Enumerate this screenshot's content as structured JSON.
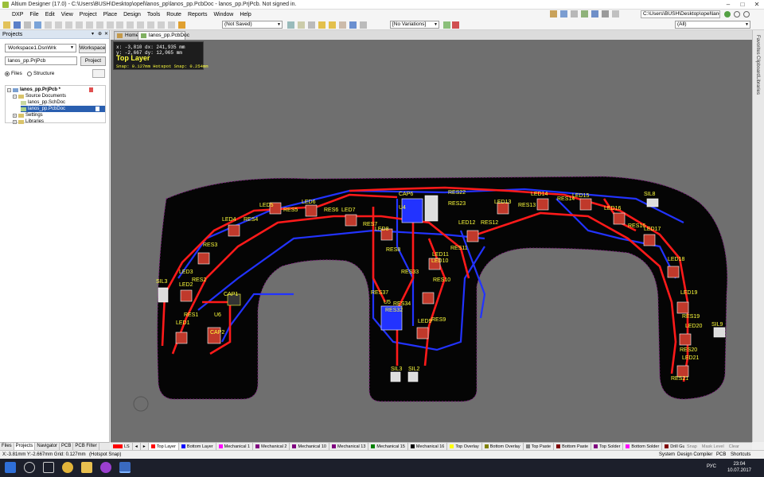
{
  "window": {
    "title": "Altium Designer (17.0) - C:\\Users\\BUSH\\Desktop\\opel\\lanos_pp\\lanos_pp.PcbDoc - lanos_pp.PrjPcb. Not signed in.",
    "path_box": "C:\\Users\\BUSH\\Desktop\\opel\\lano",
    "min": "–",
    "max": "□",
    "close": "✕"
  },
  "menu": [
    "DXP",
    "File",
    "Edit",
    "View",
    "Project",
    "Place",
    "Design",
    "Tools",
    "Route",
    "Reports",
    "Window",
    "Help"
  ],
  "toolbar": {
    "saved_combo": "(Not Saved)",
    "variations_combo": "[No Variations]",
    "filter_combo": "(All)"
  },
  "panel": {
    "title": "Projects",
    "workspace_field": "Workspace1.DsnWrk",
    "workspace_button": "Workspace",
    "project_field": "lanos_pp.PrjPcb",
    "project_button": "Project",
    "radio_files": "Files",
    "radio_structure": "Structure",
    "tree": [
      {
        "label": "lanos_pp.PrjPcb *",
        "level": 0
      },
      {
        "label": "Source Documents",
        "level": 1
      },
      {
        "label": "lanos_pp.SchDoc",
        "level": 2
      },
      {
        "label": "lanos_pp.PcbDoc",
        "level": 2,
        "selected": true
      },
      {
        "label": "Settings",
        "level": 1
      },
      {
        "label": "Libraries",
        "level": 1
      }
    ],
    "bottom_tabs": [
      "Files",
      "Projects",
      "Navigator",
      "PCB",
      "PCB Filter"
    ]
  },
  "doc_tabs": [
    "Home",
    "lanos_pp.PcbDoc"
  ],
  "hud": {
    "line1": "x: -3,810   dx: 241,935  mm",
    "line2": "y: -2,667   dy: 12,065   mm",
    "layer": "Top Layer",
    "snap": "Snap: 0.127mm Hotspot Snap: 0.254mm"
  },
  "right_strip": [
    "Favorites",
    "Clipboard",
    "Libraries"
  ],
  "pcb_labels": [
    "CAP6",
    "RES22",
    "LED14",
    "LED15",
    "LED13",
    "RES14",
    "SIL8",
    "LED5",
    "LED6",
    "RES5",
    "RES4",
    "RES6",
    "LED7",
    "LED4",
    "RES23",
    "LED12",
    "RES13",
    "LED16",
    "RES16",
    "RES12",
    "LED17",
    "RES3",
    "RES7",
    "LED8",
    "RES8",
    "RES11",
    "LED11",
    "LED3",
    "RES2",
    "LED10",
    "RES33",
    "LED18",
    "SIL3",
    "LED2",
    "RES10",
    "CAP1",
    "RES37",
    "RES34",
    "LED19",
    "RES32",
    "RES1",
    "LED1",
    "U6",
    "LED9",
    "RES9",
    "RES19",
    "LED20",
    "SIL9",
    "CAP2",
    "RES20",
    "LED21",
    "RES21",
    "SIL3",
    "SIL2",
    "U4",
    "U5"
  ],
  "layers": [
    {
      "name": "LS",
      "color": "#ff0000"
    },
    {
      "name": "Top Layer",
      "color": "#ff0000"
    },
    {
      "name": "Bottom Layer",
      "color": "#0000ff"
    },
    {
      "name": "Mechanical 1",
      "color": "#ff00ff"
    },
    {
      "name": "Mechanical 2",
      "color": "#800080"
    },
    {
      "name": "Mechanical 10",
      "color": "#800080"
    },
    {
      "name": "Mechanical 13",
      "color": "#800080"
    },
    {
      "name": "Mechanical 15",
      "color": "#008000"
    },
    {
      "name": "Mechanical 16",
      "color": "#000000"
    },
    {
      "name": "Top Overlay",
      "color": "#ffff00"
    },
    {
      "name": "Bottom Overlay",
      "color": "#808000"
    },
    {
      "name": "Top Paste",
      "color": "#808080"
    },
    {
      "name": "Bottom Paste",
      "color": "#800000"
    },
    {
      "name": "Top Solder",
      "color": "#800080"
    },
    {
      "name": "Bottom Solder",
      "color": "#ff00ff"
    },
    {
      "name": "Drill Guide",
      "color": "#800000"
    }
  ],
  "layer_tail": {
    "snap": "Snap",
    "mask": "Mask Level",
    "clear": "Clear"
  },
  "status": {
    "coords": "X:-3.81mm Y:-2.667mm   Grid: 0.127mm",
    "snap": "(Hotspot Snap)",
    "right_items": [
      "System",
      "Design Compiler",
      "PCB",
      "Shortcuts"
    ]
  },
  "taskbar": {
    "lang": "РУС",
    "time": "23:04",
    "date": "10.07.2017"
  }
}
